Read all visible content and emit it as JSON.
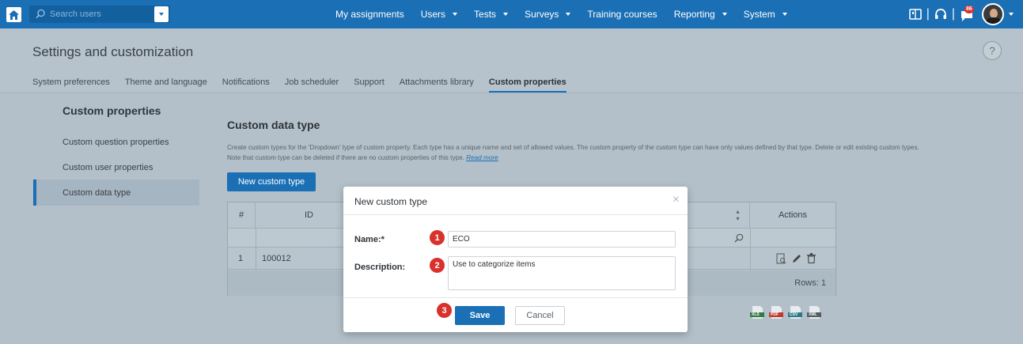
{
  "topbar": {
    "search_placeholder": "Search users",
    "nav": [
      {
        "label": "My assignments",
        "has_caret": false
      },
      {
        "label": "Users",
        "has_caret": true
      },
      {
        "label": "Tests",
        "has_caret": true
      },
      {
        "label": "Surveys",
        "has_caret": true
      },
      {
        "label": "Training courses",
        "has_caret": false
      },
      {
        "label": "Reporting",
        "has_caret": true
      },
      {
        "label": "System",
        "has_caret": true
      }
    ],
    "notification_count": "86",
    "separator": "|"
  },
  "header": {
    "title": "Settings and customization",
    "help": "?",
    "tabs": [
      {
        "label": "System preferences"
      },
      {
        "label": "Theme and language"
      },
      {
        "label": "Notifications"
      },
      {
        "label": "Job scheduler"
      },
      {
        "label": "Support"
      },
      {
        "label": "Attachments library"
      },
      {
        "label": "Custom properties"
      }
    ],
    "active_tab": "Custom properties"
  },
  "sidebar": {
    "heading": "Custom properties",
    "items": [
      {
        "label": "Custom question properties"
      },
      {
        "label": "Custom user properties"
      },
      {
        "label": "Custom data type"
      }
    ],
    "active_item": "Custom data type"
  },
  "main": {
    "title": "Custom data type",
    "description": "Create custom types for the 'Dropdown' type of custom property. Each type has a unique name and set of allowed values. The custom property of the custom type can have only values defined by that type. Delete or edit existing custom types.",
    "description2": "Note that custom type can be deleted if there are no custom properties of this type.",
    "read_more": "Read more",
    "new_button": "New custom type",
    "table": {
      "headers": [
        "#",
        "ID",
        "",
        "Actions"
      ],
      "rows": [
        {
          "num": "1",
          "id": "100012"
        }
      ],
      "rows_label": "Rows: 1"
    },
    "exports": [
      "XLS",
      "PDF",
      "CSV",
      "XML"
    ]
  },
  "modal": {
    "title": "New custom type",
    "close": "×",
    "name_label": "Name:*",
    "name_value": "ECO",
    "description_label": "Description:",
    "description_value": "Use to categorize items",
    "save_label": "Save",
    "cancel_label": "Cancel",
    "badges": [
      "1",
      "2",
      "3"
    ]
  },
  "colors": {
    "brand": "#1a6fb5",
    "badge": "#d9312b"
  }
}
